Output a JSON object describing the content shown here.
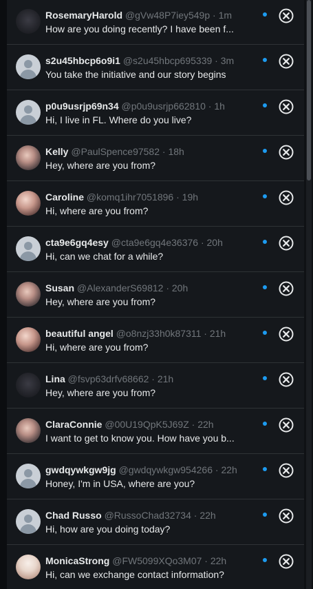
{
  "colors": {
    "background": "#15181c",
    "text": "#e7e9ea",
    "secondary": "#71767b",
    "unread_dot": "#1d9bf0",
    "divider": "#2f3336"
  },
  "conversations": [
    {
      "name": "RosemaryHarold",
      "handle": "@gVw48P7iey549p",
      "time": "1m",
      "message": "How are you doing recently? I have been f...",
      "avatar": "photo-dark"
    },
    {
      "name": "s2u45hbcp6o9i1",
      "handle": "@s2u45hbcp695339",
      "time": "3m",
      "message": "You take the initiative and our story begins",
      "avatar": "default-avatar"
    },
    {
      "name": "p0u9usrjp69n34",
      "handle": "@p0u9usrjp662810",
      "time": "1h",
      "message": "Hi, I live in FL. Where do you live?",
      "avatar": "default-avatar"
    },
    {
      "name": "Kelly",
      "handle": "@PaulSpence97582",
      "time": "18h",
      "message": "Hey, where are you from?",
      "avatar": "photo"
    },
    {
      "name": "Caroline",
      "handle": "@komq1ihr7051896",
      "time": "19h",
      "message": "Hi, where are you from?",
      "avatar": "photo-warm"
    },
    {
      "name": "cta9e6gq4esy",
      "handle": "@cta9e6gq4e36376",
      "time": "20h",
      "message": "Hi, can we chat for a while?",
      "avatar": "default-avatar"
    },
    {
      "name": "Susan",
      "handle": "@AlexanderS69812",
      "time": "20h",
      "message": "Hey, where are you from?",
      "avatar": "photo"
    },
    {
      "name": "beautiful angel",
      "handle": "@o8nzj33h0k87311",
      "time": "21h",
      "message": "Hi, where are you from?",
      "avatar": "photo-warm"
    },
    {
      "name": "Lina",
      "handle": "@fsvp63drfv68662",
      "time": "21h",
      "message": "Hey, where are you from?",
      "avatar": "photo-dark"
    },
    {
      "name": "ClaraConnie",
      "handle": "@00U19QpK5J69Z",
      "time": "22h",
      "message": "I want to get to know you. How have you b...",
      "avatar": "photo"
    },
    {
      "name": "gwdqywkgw9jg",
      "handle": "@gwdqywkgw954266",
      "time": "22h",
      "message": "Honey, I'm in USA, where are you?",
      "avatar": "default-avatar"
    },
    {
      "name": "Chad Russo",
      "handle": "@RussoChad32734",
      "time": "22h",
      "message": "Hi, how are you doing today?",
      "avatar": "default-avatar"
    },
    {
      "name": "MonicaStrong",
      "handle": "@FW5099XQo3M07",
      "time": "22h",
      "message": "Hi, can we exchange contact information?",
      "avatar": "photo-light"
    }
  ],
  "icons": {
    "dismiss": "close-circle-icon",
    "unread": "unread-dot-icon"
  }
}
